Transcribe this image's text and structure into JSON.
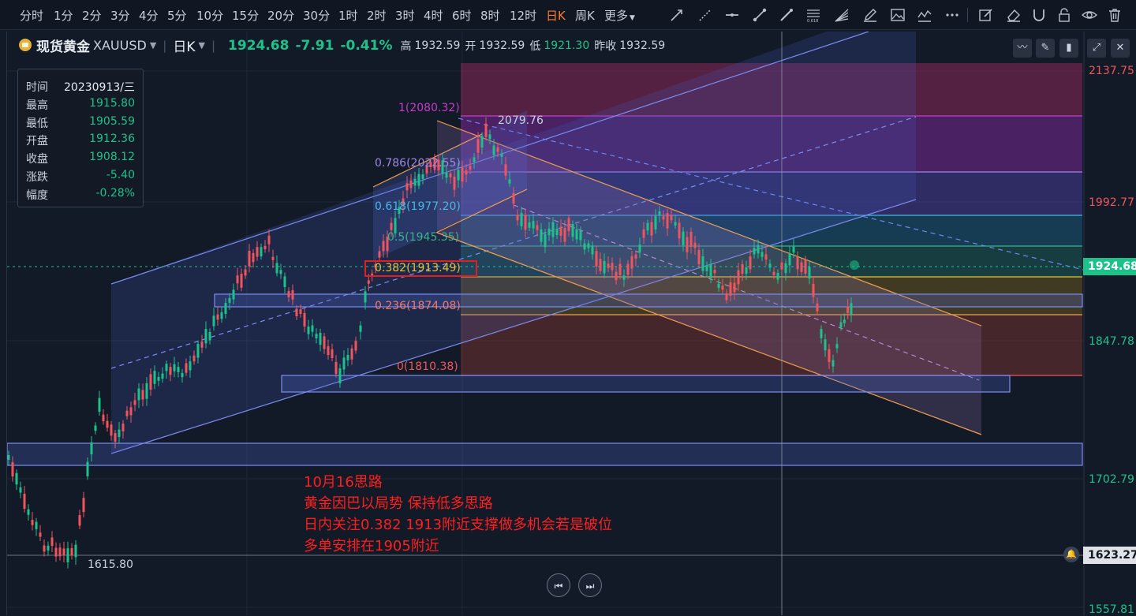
{
  "timeframes": [
    {
      "label": "分时"
    },
    {
      "label": "1分"
    },
    {
      "label": "2分"
    },
    {
      "label": "3分"
    },
    {
      "label": "4分"
    },
    {
      "label": "5分"
    },
    {
      "label": "10分"
    },
    {
      "label": "15分"
    },
    {
      "label": "20分"
    },
    {
      "label": "30分"
    },
    {
      "label": "1时"
    },
    {
      "label": "2时"
    },
    {
      "label": "3时"
    },
    {
      "label": "4时"
    },
    {
      "label": "6时"
    },
    {
      "label": "8时"
    },
    {
      "label": "12时"
    },
    {
      "label": "日K"
    },
    {
      "label": "周K"
    },
    {
      "label": "更多"
    }
  ],
  "active_timeframe": "日K",
  "tools": [
    "trend-line-icon",
    "ray-line-icon",
    "horizontal-line-icon",
    "segment-icon",
    "brush-line-icon",
    "fibonacci-icon",
    "fan-icon",
    "pen-icon",
    "image-icon",
    "wave-icon",
    "more-dots-icon",
    "edit-icon",
    "eraser-icon",
    "magnet-icon",
    "lock-icon",
    "eye-icon",
    "trash-icon"
  ],
  "header": {
    "name": "现货黄金",
    "code": "XAUUSD",
    "period": "日K",
    "price": "1924.68",
    "change": "-7.91",
    "change_pct": "-0.41%",
    "high_label": "高",
    "high": "1932.59",
    "open_label": "开",
    "open": "1932.59",
    "low_label": "低",
    "low": "1921.30",
    "prev_label": "昨收",
    "prev": "1932.59"
  },
  "infobox": {
    "time_label": "时间",
    "time": "20230913/三",
    "high_label": "最高",
    "high": "1915.80",
    "low_label": "最低",
    "low": "1905.59",
    "open_label": "开盘",
    "open": "1912.36",
    "close_label": "收盘",
    "close": "1908.12",
    "chg_label": "涨跌",
    "chg": "-5.40",
    "amp_label": "幅度",
    "amp": "-0.28%"
  },
  "axis": {
    "labels": [
      "2137.75",
      "1992.77",
      "1847.78",
      "1702.79",
      "1557.81"
    ],
    "current_price": "1924.68",
    "crosshair_price": "1623.27"
  },
  "fib": [
    {
      "label": "1(2080.32)",
      "color": "#c43cc8"
    },
    {
      "label": "0.786(2022.55)",
      "color": "#9d86e8"
    },
    {
      "label": "0.618(1977.20)",
      "color": "#47b7e6"
    },
    {
      "label": "0.5(1945.35)",
      "color": "#39b38a"
    },
    {
      "label": "0.382(1913.49)",
      "color": "#e6c23a"
    },
    {
      "label": "0.236(1874.08)",
      "color": "#f07a6a"
    },
    {
      "label": "0(1810.38)",
      "color": "#f0545c"
    }
  ],
  "peak_label": "2079.76",
  "trough_label": "1615.80",
  "annotation": [
    "10月16思路",
    "黄金因巴以局势  保持低多思路",
    "日内关注0.382 1913附近支撑做多机会若是破位",
    "多单安排在1905附近"
  ],
  "colors": {
    "up": "#1dc28a",
    "down": "#f0545c",
    "bg": "#131a27",
    "accent": "#ff7a2e"
  }
}
